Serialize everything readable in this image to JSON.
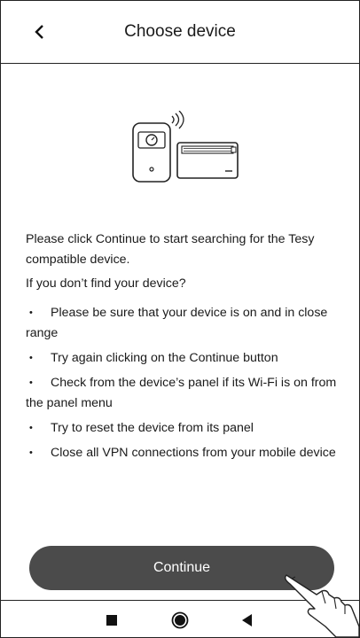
{
  "header": {
    "title": "Choose device",
    "back_icon": "chevron-left-icon"
  },
  "content": {
    "intro": "Please click Continue to start searching for the Tesy compatible device.",
    "question": "If you don’t find your device?",
    "bullet_symbol": "•",
    "tips": [
      "Please be sure that your device is on and in close range",
      "Try again clicking on the Continue button",
      "Check from the device’s panel if its Wi-Fi is on from the panel menu",
      "Try to reset the device from its panel",
      "Close all VPN connections from your mobile device"
    ]
  },
  "actions": {
    "continue_label": "Continue"
  },
  "colors": {
    "button_bg": "#4b4b4b",
    "button_text": "#ffffff",
    "border": "#222222"
  },
  "navbar": {
    "icons": [
      "recents-square-icon",
      "home-circle-icon",
      "back-triangle-icon"
    ]
  }
}
